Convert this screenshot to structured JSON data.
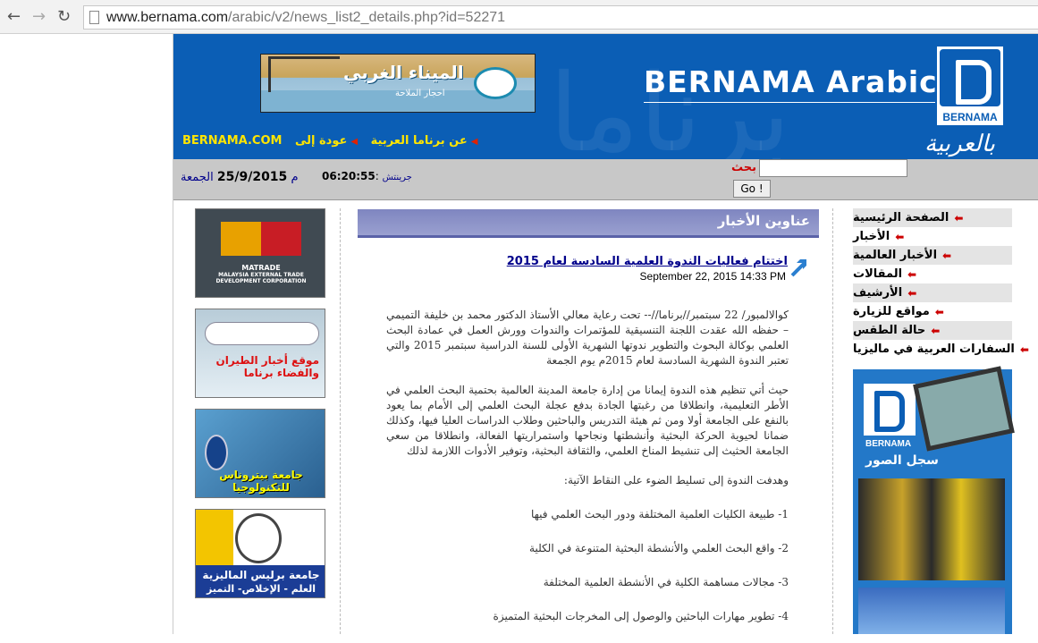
{
  "browser": {
    "url_domain": "www.bernama.com",
    "url_rest": "/arabic/v2/news_list2_details.php?id=52271"
  },
  "header": {
    "site_title": "BERNAMA Arabic",
    "logo_text": "BERNAMA",
    "arabic_logo": "بالعربية",
    "ad_title": "الميناء الغربي",
    "ad_sub": "احجار الملاحة",
    "links": [
      "BERNAMA.COM",
      "عودة إلى",
      "عن برناما العربية"
    ]
  },
  "infobar": {
    "day": "الجمعة",
    "date": "25/9/2015",
    "suffix": "م",
    "time": "06:20:55",
    "tz": "جرينتش",
    "search_label": "بحث",
    "go": "Go !"
  },
  "ads": {
    "matrade": "MATRADE",
    "matrade_sub": "MALAYSIA EXTERNAL TRADE DEVELOPMENT CORPORATION",
    "airline": "موقع أخبار الطيران والفضاء برناما",
    "petronas": "جامعة بيتروناس للتكنولوجيا",
    "unimap1": "جامعة برليس الماليزية",
    "unimap2": "العلم - الإخلاص- التميز",
    "unimap_logo": "UniMAP"
  },
  "main": {
    "heading": "عناوين الأخبار",
    "article": {
      "title": "اختتام فعاليات الندوة العلمية السادسة لعام 2015",
      "date": "September 22, 2015 14:33 PM",
      "paragraphs": [
        "كوالالمبور/ 22 سبتمبر//برناما//-- تحت رعاية معالي الأستاذ الدكتور محمد بن خليفة التميمي – حفظه الله عقدت اللجنة التنسيقية للمؤتمرات والندوات وورش العمل في عمادة البحث العلمي بوكالة البحوث والتطوير ندوتها الشهرية الأولى للسنة الدراسية سبتمبر 2015 والتي تعتبر الندوة الشهرية السادسة لعام 2015م يوم الجمعة",
        "حيث أتي تنظيم هذه الندوة إيمانا من إدارة جامعة المدينة العالمية بحتمية البحث العلمي في الأطر التعليمية، وانطلاقا من رغبتها الجادة بدفع عجلة البحث العلمي إلى الأمام بما يعود بالنفع على الجامعة أولا ومن ثم هيئة التدريس والباحثين وطلاب الدراسات العليا فيها، وكذلك ضمانا لحيوية الحركة البحثية وأنشطتها ونجاحها واستمراريتها الفعالة، وانطلاقا من سعي الجامعة الحثيث إلى تنشيط المناخ العلمي، والثقافة البحثية، وتوفير الأدوات اللازمة لذلك",
        "وهدفت الندوة إلى تسليط الضوء على النقاط الآتية:",
        "1- طبيعة الكليات العلمية المختلفة ودور البحث العلمي فيها",
        "2- واقع البحث العلمي والأنشطة البحثية المتنوعة في الكلية",
        "3- مجالات مساهمة الكلية في الأنشطة العلمية المختلفة",
        "4- تطوير مهارات الباحثين والوصول إلى المخرجات البحثية المتميزة"
      ]
    }
  },
  "sidebar": {
    "items": [
      "الصفحة الرئيسية",
      "الأخبار",
      "الأخبار العالمية",
      "المقالات",
      "الأرشيف",
      "مواقع للزيارة",
      "حالة الطقس",
      "السفارات العربية في ماليزيا"
    ],
    "gallery_title": "سجل الصور",
    "gallery_logo": "BERNAMA"
  }
}
